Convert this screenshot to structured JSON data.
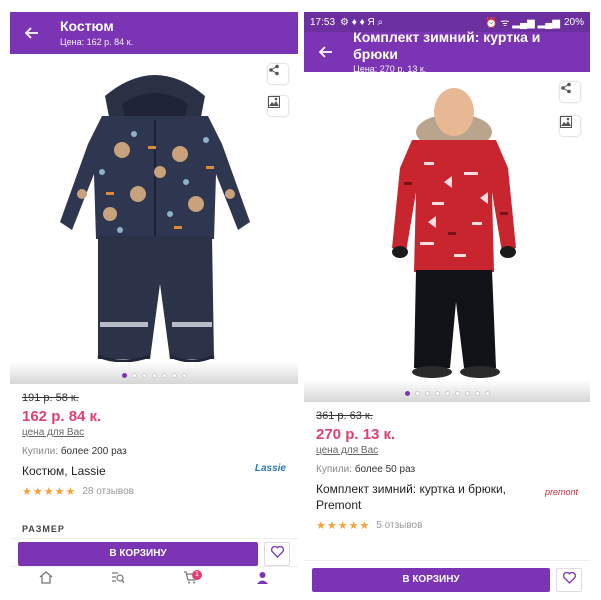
{
  "left": {
    "appbar": {
      "title": "Костюм",
      "subtitle": "Цена: 162 р. 84 к."
    },
    "product": {
      "old_price": "191 р. 58 к.",
      "price": "162 р. 84 к.",
      "price_note": "цена для Вас",
      "bought_label": "Купили:",
      "bought_value": "более 200 раз",
      "name": "Костюм, Lassie",
      "brand": "Lassie",
      "stars": "★★★★★",
      "reviews": "28 отзывов"
    },
    "size_label": "РАЗМЕР",
    "cart_label": "В КОРЗИНУ",
    "cart_badge": "1",
    "gallery": {
      "count": 7,
      "active": 0
    }
  },
  "right": {
    "statusbar": {
      "time": "17:53",
      "icons_left": "⚙ ♦ ♦ Я ⌕",
      "icons_right": "⏰ ᯤ ▂▄▆ ▂▄▆",
      "battery": "20%"
    },
    "appbar": {
      "title": "Комплект зимний: куртка и брюки",
      "subtitle": "Цена: 270 р. 13 к."
    },
    "product": {
      "old_price": "361 р. 63 к.",
      "price": "270 р. 13 к.",
      "price_note": "цена для Вас",
      "bought_label": "Купили:",
      "bought_value": "более 50 раз",
      "name": "Комплект зимний: куртка и брюки, Premont",
      "brand": "premont",
      "stars": "★★★★★",
      "reviews": "5 отзывов"
    },
    "cart_label": "В КОРЗИНУ",
    "gallery": {
      "count": 9,
      "active": 0
    }
  },
  "colors": {
    "brand_purple": "#7b35b4",
    "price_pink": "#e0406f",
    "star_orange": "#f2a33a"
  },
  "icons": [
    "back-arrow-icon",
    "share-icon",
    "image-search-icon",
    "heart-icon",
    "home-icon",
    "catalog-search-icon",
    "cart-icon",
    "profile-icon"
  ]
}
